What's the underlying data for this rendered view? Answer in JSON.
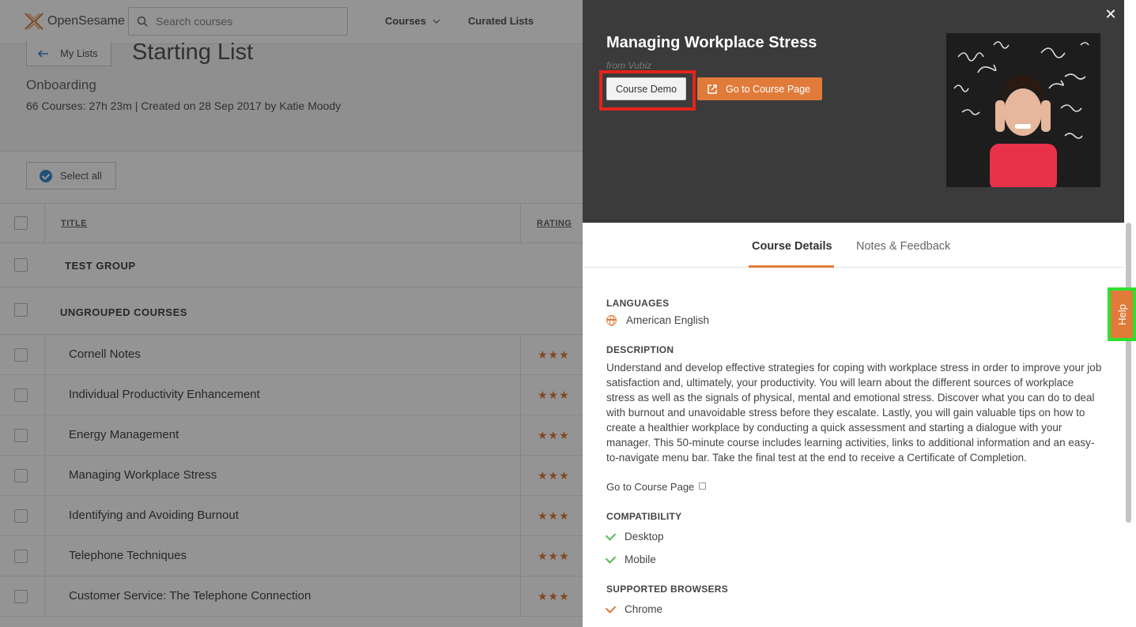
{
  "header": {
    "logo_text": "OpenSesame",
    "search_placeholder": "Search courses",
    "nav_courses": "Courses",
    "nav_curated": "Curated Lists"
  },
  "list_info": {
    "back_label": "My Lists",
    "title": "Starting List",
    "subtitle": "Onboarding",
    "meta": "66 Courses: 27h 23m | Created on 28 Sep 2017 by Katie Moody",
    "select_all": "Select all"
  },
  "table": {
    "col_title": "TITLE",
    "col_rating": "RATING",
    "groups": [
      "TEST GROUP",
      "UNGROUPED COURSES"
    ],
    "rows": [
      "Cornell Notes",
      "Individual Productivity Enhancement",
      "Energy Management",
      "Managing Workplace Stress",
      "Identifying and Avoiding Burnout",
      "Telephone Techniques",
      "Customer Service: The Telephone Connection"
    ],
    "stars": "★★★"
  },
  "panel": {
    "title": "Managing Workplace Stress",
    "from": "from Vubiz",
    "demo_label": "Course Demo",
    "go_label": "Go to Course Page",
    "close": "✕",
    "tabs": [
      "Course Details",
      "Notes & Feedback"
    ],
    "languages_h": "LANGUAGES",
    "language": "American English",
    "description_h": "DESCRIPTION",
    "description": "Understand and develop effective strategies for coping with workplace stress in order to improve your job satisfaction and, ultimately, your productivity. You will learn about the different sources of workplace stress as well as the signals of physical, mental and emotional stress. Discover what you can do to deal with burnout and unavoidable stress before they escalate. Lastly, you will gain valuable tips on how to create a healthier workplace by conducting a quick assessment and starting a dialogue with your manager. This 50-minute course includes learning activities, links to additional information and an easy-to-navigate menu bar. Take the final test at the end to receive a Certificate of Completion.",
    "course_link": "Go to Course Page",
    "compat_h": "COMPATIBILITY",
    "compat": [
      "Desktop",
      "Mobile"
    ],
    "browsers_h": "SUPPORTED BROWSERS",
    "browsers": [
      "Chrome"
    ]
  },
  "help_label": "Help",
  "colors": {
    "accent": "#e07b3a",
    "panel_header": "#3b3b3b",
    "highlight_red": "#e3241b",
    "highlight_green": "#2fe02f"
  }
}
